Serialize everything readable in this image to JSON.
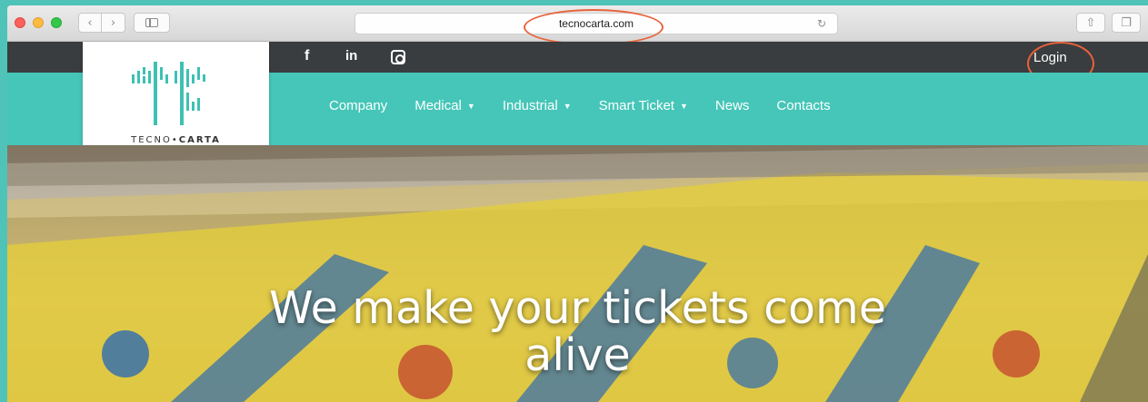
{
  "browser": {
    "url": "tecnocarta.com",
    "back_glyph": "‹",
    "forward_glyph": "›",
    "reload_glyph": "↻",
    "share_glyph": "⇧",
    "tabs_glyph": "❐"
  },
  "site": {
    "social": {
      "facebook": "f",
      "linkedin": "in"
    },
    "login_label": "Login",
    "logo": {
      "part1": "TECNO",
      "separator": "•",
      "part2": "CARTA"
    },
    "menu": [
      {
        "label": "Company",
        "dropdown": false
      },
      {
        "label": "Medical",
        "dropdown": true
      },
      {
        "label": "Industrial",
        "dropdown": true
      },
      {
        "label": "Smart Ticket",
        "dropdown": true
      },
      {
        "label": "News",
        "dropdown": false
      },
      {
        "label": "Contacts",
        "dropdown": false
      }
    ],
    "hero": {
      "line1": "We make your tickets come",
      "line2": "alive"
    }
  },
  "colors": {
    "background": "#4fc3b8",
    "topstrip": "#3a3d3f",
    "navbar": "#45c6b8",
    "highlight": "#e8623a"
  },
  "icons": [
    "facebook-icon",
    "linkedin-icon",
    "instagram-icon",
    "reload-icon",
    "share-icon",
    "tabs-icon",
    "sidebar-icon"
  ]
}
